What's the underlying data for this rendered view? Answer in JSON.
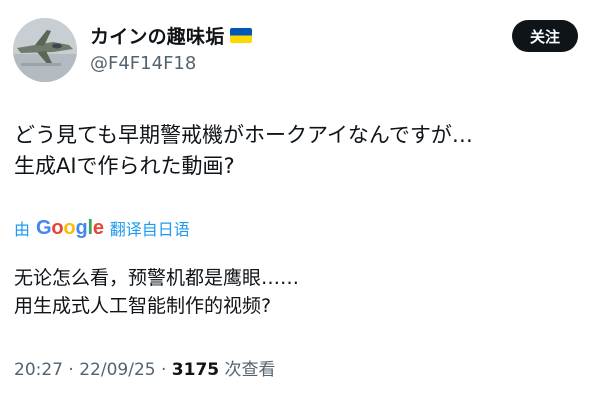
{
  "user": {
    "display_name": "カインの趣味垢",
    "flag_icon": "ukraine-flag-icon",
    "handle": "@F4F14F18"
  },
  "follow_button": {
    "label": "关注"
  },
  "tweet": {
    "lines": [
      "どう見ても早期警戒機がホークアイなんですが…",
      "生成AIで作られた動画?"
    ]
  },
  "translation": {
    "prefix": "由",
    "google": [
      "G",
      "o",
      "o",
      "g",
      "l",
      "e"
    ],
    "label": "翻译自日语",
    "lines": [
      "无论怎么看，预警机都是鹰眼……",
      "用生成式人工智能制作的视频?"
    ]
  },
  "meta": {
    "time": "20:27",
    "sep1": " · ",
    "date": "22/09/25",
    "sep2": " · ",
    "views": "3175",
    "views_label": " 次查看"
  },
  "colors": {
    "link": "#1d9bf0",
    "muted": "#536471",
    "text": "#0f1419",
    "flag_blue": "#0057b7",
    "flag_yellow": "#ffd700"
  }
}
